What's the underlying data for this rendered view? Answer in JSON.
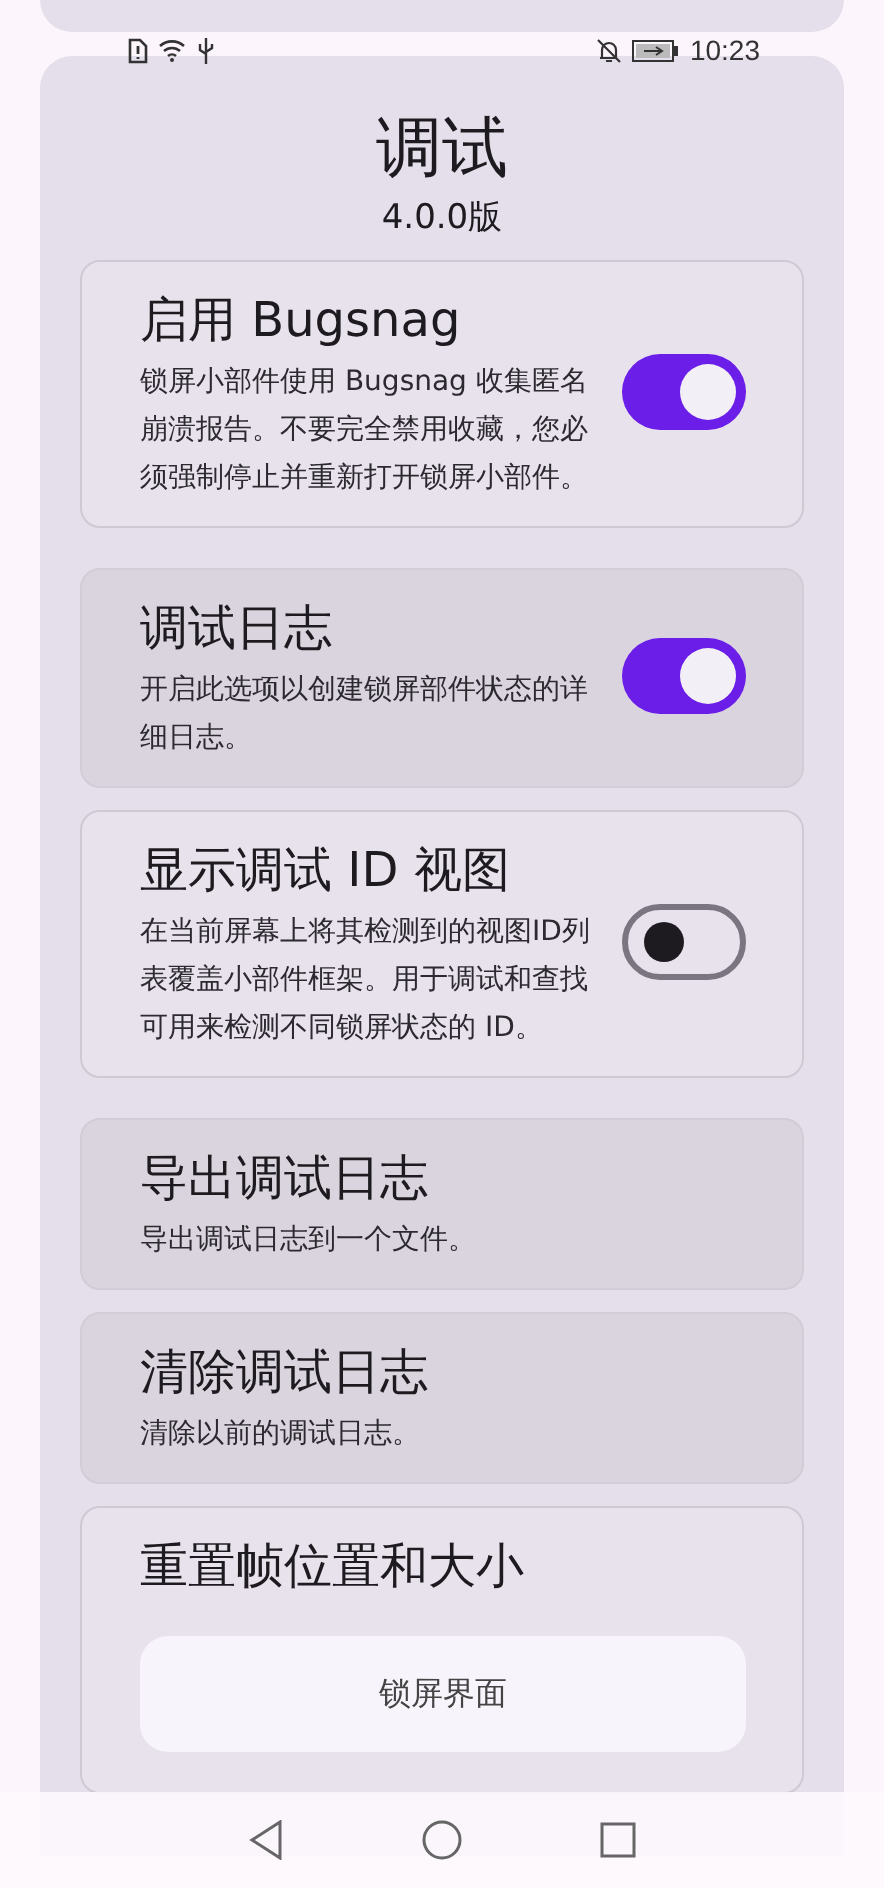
{
  "status_bar": {
    "time": "10:23"
  },
  "header": {
    "title": "调试",
    "version": "4.0.0版"
  },
  "settings": [
    {
      "kind": "toggle",
      "title": "启用 Bugsnag",
      "description": "锁屏小部件使用 Bugsnag 收集匿名崩溃报告。不要完全禁用收藏，您必须强制停止并重新打开锁屏小部件。",
      "highlighted": false,
      "on": true
    },
    {
      "kind": "toggle",
      "title": "调试日志",
      "description": "开启此选项以创建锁屏部件状态的详细日志。",
      "highlighted": true,
      "on": true
    },
    {
      "kind": "toggle",
      "title": "显示调试 ID 视图",
      "description": "在当前屏幕上将其检测到的视图ID列表覆盖小部件框架。用于调试和查找可用来检测不同锁屏状态的 ID。",
      "highlighted": false,
      "on": false
    },
    {
      "kind": "action",
      "title": "导出调试日志",
      "description": "导出调试日志到一个文件。",
      "highlighted": true
    },
    {
      "kind": "action",
      "title": "清除调试日志",
      "description": "清除以前的调试日志。",
      "highlighted": true
    },
    {
      "kind": "group",
      "title": "重置帧位置和大小",
      "highlighted": false,
      "buttons": [
        "锁屏界面"
      ]
    }
  ]
}
